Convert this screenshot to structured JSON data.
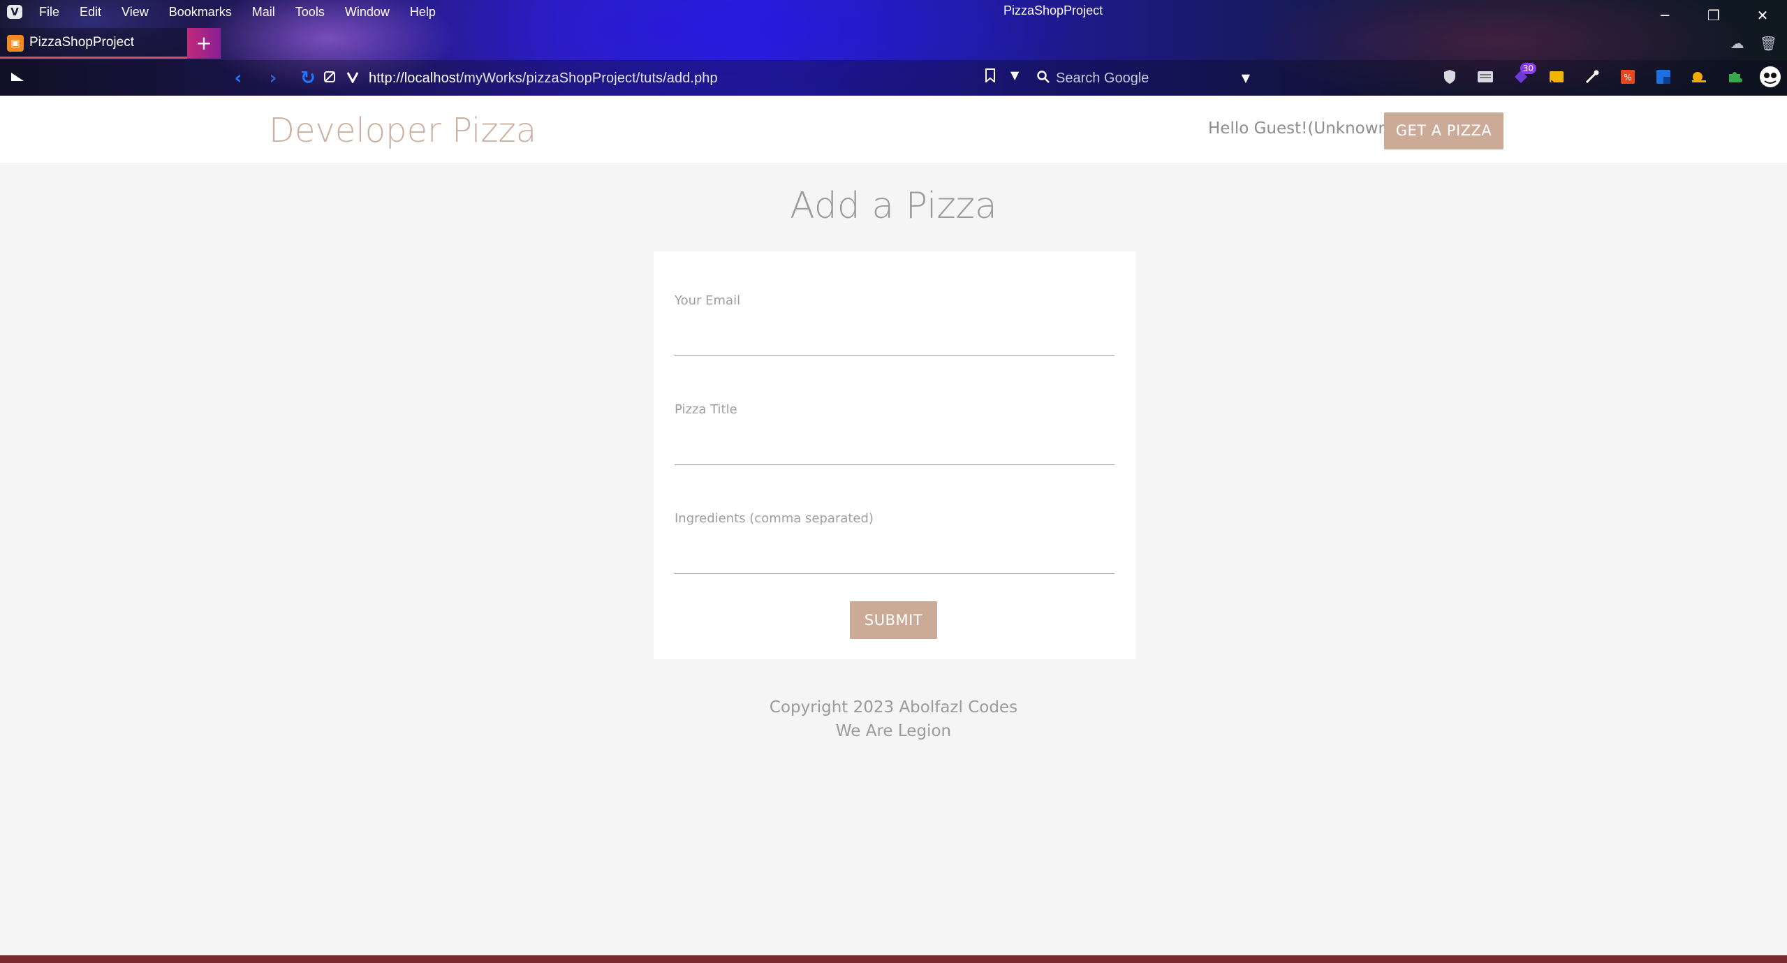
{
  "browser": {
    "logo": "V",
    "menu": [
      "File",
      "Edit",
      "View",
      "Bookmarks",
      "Mail",
      "Tools",
      "Window",
      "Help"
    ],
    "window_title": "PizzaShopProject",
    "window_controls": {
      "minimize": "─",
      "restore": "❐",
      "close": "✕"
    },
    "tab": {
      "title": "PizzaShopProject",
      "favicon": "▣"
    },
    "new_tab": "+",
    "url_host": "http://localhost",
    "url_path": "/myWorks/pizzaShopProject/tuts/add.php",
    "search_placeholder": "Search Google",
    "extension_badge": "30",
    "icons": {
      "back": "‹",
      "forward": "›",
      "reload": "↻",
      "bookmark": "🔖",
      "search": "🔍",
      "shield": "🛡",
      "cloud": "☁",
      "trash": "🗑"
    }
  },
  "site": {
    "brand": "Developer Pizza",
    "greeting": "Hello Guest!(Unknown)",
    "cta_label": "GET A PIZZA",
    "accent_color": "#cbab98"
  },
  "form": {
    "title": "Add a Pizza",
    "fields": [
      {
        "label": "Your Email",
        "value": ""
      },
      {
        "label": "Pizza Title",
        "value": ""
      },
      {
        "label": "Ingredients (comma separated)",
        "value": ""
      }
    ],
    "submit_label": "SUBMIT"
  },
  "footer": {
    "line1": "Copyright 2023 Abolfazl Codes",
    "line2": "We Are Legion"
  }
}
